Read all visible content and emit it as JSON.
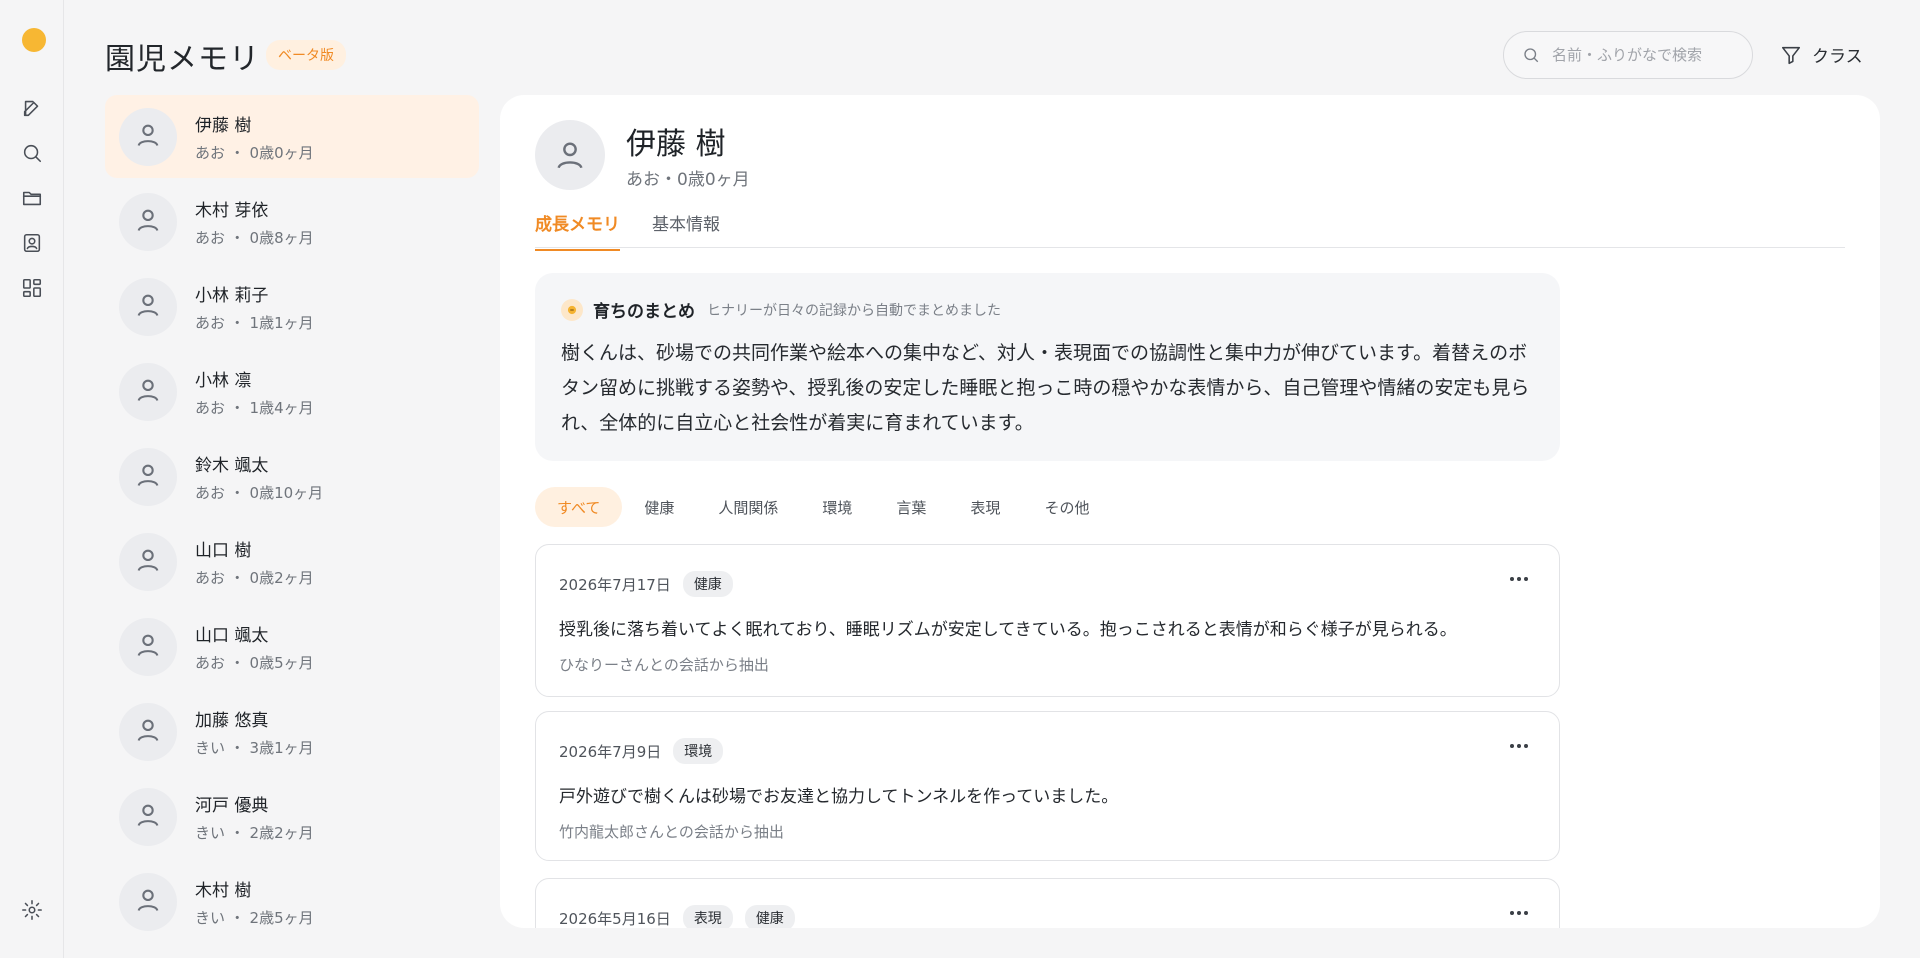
{
  "header": {
    "title": "園児メモリ",
    "badge": "ベータ版",
    "search_placeholder": "名前・ふりがなで検索",
    "filter_label": "クラス"
  },
  "rail": {
    "icons": [
      "logo-icon",
      "edit-icon",
      "search-icon",
      "folder-icon",
      "contact-card-icon",
      "dashboard-icon",
      "settings-icon"
    ]
  },
  "children": [
    {
      "name": "伊藤 樹",
      "sub": "あお ・ 0歳0ヶ月"
    },
    {
      "name": "木村 芽依",
      "sub": "あお ・ 0歳8ヶ月"
    },
    {
      "name": "小林 莉子",
      "sub": "あお ・ 1歳1ヶ月"
    },
    {
      "name": "小林 凛",
      "sub": "あお ・ 1歳4ヶ月"
    },
    {
      "name": "鈴木 颯太",
      "sub": "あお ・ 0歳10ヶ月"
    },
    {
      "name": "山口 樹",
      "sub": "あお ・ 0歳2ヶ月"
    },
    {
      "name": "山口 颯太",
      "sub": "あお ・ 0歳5ヶ月"
    },
    {
      "name": "加藤 悠真",
      "sub": "きい ・ 3歳1ヶ月"
    },
    {
      "name": "河戸 優典",
      "sub": "きい ・ 2歳2ヶ月"
    },
    {
      "name": "木村 樹",
      "sub": "きい ・ 2歳5ヶ月"
    }
  ],
  "detail": {
    "name": "伊藤 樹",
    "sub": "あお・0歳0ヶ月",
    "tabs": [
      "成長メモリ",
      "基本情報"
    ],
    "summary": {
      "title": "育ちのまとめ",
      "note": "ヒナリーが日々の記録から自動でまとめました",
      "body": "樹くんは、砂場での共同作業や絵本への集中など、対人・表現面での協調性と集中力が伸びています。着替えのボタン留めに挑戦する姿勢や、授乳後の安定した睡眠と抱っこ時の穏やかな表情から、自己管理や情緒の安定も見られ、全体的に自立心と社会性が着実に育まれています。"
    },
    "filters": [
      "すべて",
      "健康",
      "人間関係",
      "環境",
      "言葉",
      "表現",
      "その他"
    ],
    "memos": [
      {
        "date": "2026年7月17日",
        "tags": [
          "健康"
        ],
        "text": "授乳後に落ち着いてよく眠れており、睡眠リズムが安定してきている。抱っこされると表情が和らぐ様子が見られる。",
        "source": "ひなりーさんとの会話から抽出"
      },
      {
        "date": "2026年7月9日",
        "tags": [
          "環境"
        ],
        "text": "戸外遊びで樹くんは砂場でお友達と協力してトンネルを作っていました。",
        "source": "竹内龍太郎さんとの会話から抽出"
      },
      {
        "date": "2026年5月16日",
        "tags": [
          "表現",
          "健康"
        ],
        "text": "",
        "source": ""
      }
    ]
  },
  "colors": {
    "accent": "#f08a24",
    "accent_bg": "#fff0e0"
  }
}
